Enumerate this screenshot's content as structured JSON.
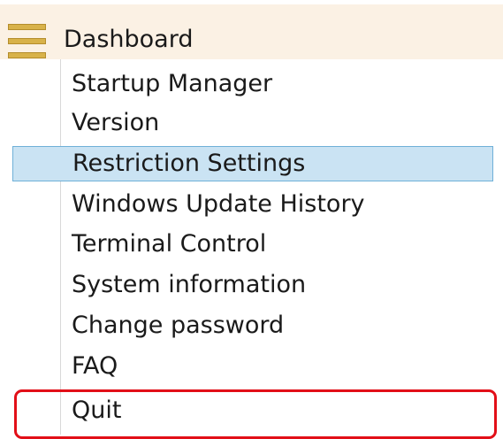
{
  "menubar": {
    "title": "Dashboard",
    "menu_icon": "hamburger-menu-icon"
  },
  "menu": {
    "items": [
      {
        "label": "Startup Manager",
        "selected": false
      },
      {
        "label": "Version",
        "selected": false
      },
      {
        "label": "Restriction Settings",
        "selected": true
      },
      {
        "label": "Windows Update History",
        "selected": false
      },
      {
        "label": "Terminal Control",
        "selected": false
      },
      {
        "label": "System information",
        "selected": false
      },
      {
        "label": "Change password",
        "selected": false
      },
      {
        "label": "FAQ",
        "selected": false
      },
      {
        "label": "Quit",
        "selected": false
      }
    ]
  },
  "colors": {
    "menubar_bg": "#fbf1e4",
    "icon": "#d8b24a",
    "selection_bg": "#cae3f3",
    "selection_border": "#6fb0d8",
    "highlight_outline": "#e20f18"
  }
}
